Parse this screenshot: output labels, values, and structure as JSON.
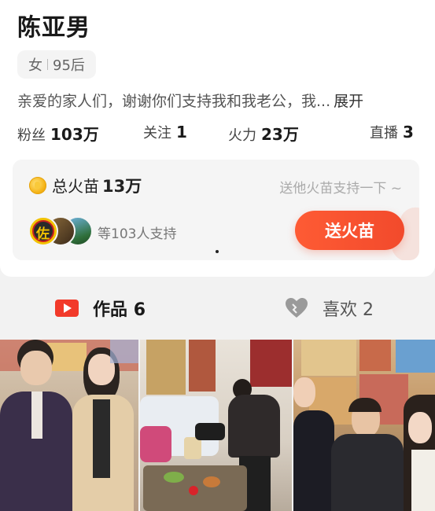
{
  "profile": {
    "name": "陈亚男",
    "gender": "女",
    "age_tag": "95后",
    "bio": "亲爱的家人们，谢谢你们支持我和我老公，我...",
    "bio_expand": "展开"
  },
  "stats": [
    {
      "label": "粉丝",
      "value": "103万"
    },
    {
      "label": "关注",
      "value": "1"
    },
    {
      "label": "火力",
      "value": "23万"
    },
    {
      "label": "直播",
      "value": "3"
    }
  ],
  "support_card": {
    "total_label": "总火苗",
    "total_value": "13万",
    "hint": "送他火苗支持一下 ~",
    "supporters_text": "等103人支持",
    "send_button": "送火苗",
    "icon": "flame-coin-icon"
  },
  "tabs": [
    {
      "label": "作品",
      "count": "6",
      "icon": "video-play-icon",
      "active": true
    },
    {
      "label": "喜欢",
      "count": "2",
      "icon": "heart-icon",
      "active": false
    }
  ],
  "colors": {
    "accent": "#f24a2c",
    "active_tab_icon": "#f23a2a",
    "background": "#f2f2f2"
  }
}
